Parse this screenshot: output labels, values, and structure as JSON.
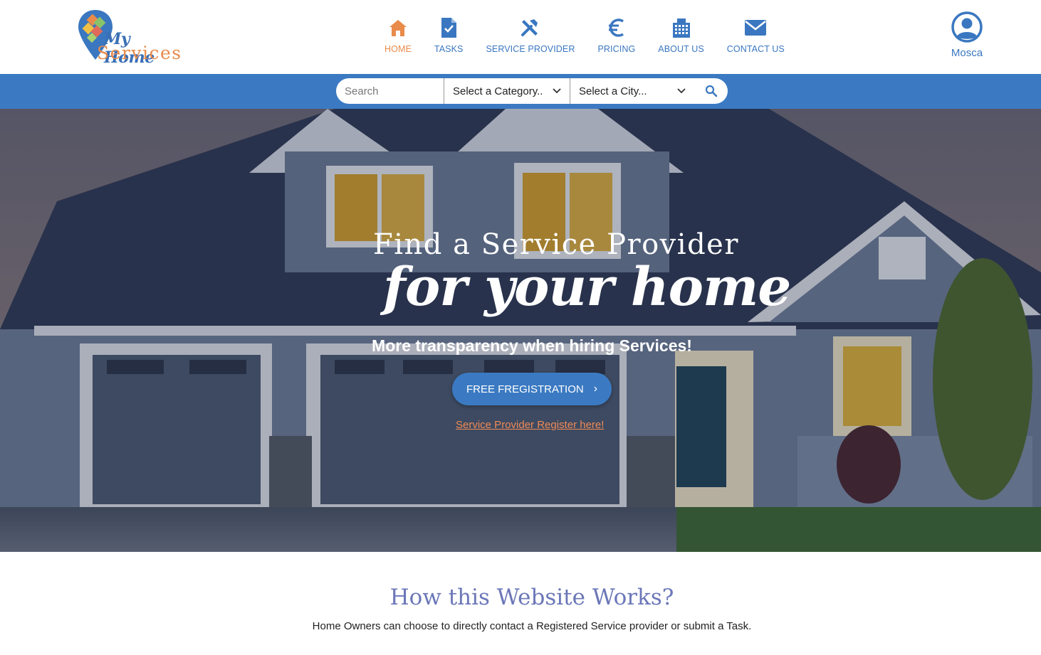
{
  "brand": {
    "line1": "My Home",
    "line2": "Services",
    "colors": {
      "primary": "#3b7ac2",
      "accent": "#e98b4a",
      "heading": "#6b77b8"
    }
  },
  "nav": {
    "items": [
      {
        "label": "HOME",
        "icon": "home-icon",
        "active": true
      },
      {
        "label": "TASKS",
        "icon": "task-check-icon",
        "active": false
      },
      {
        "label": "SERVICE PROVIDER",
        "icon": "tools-icon",
        "active": false
      },
      {
        "label": "PRICING",
        "icon": "euro-icon",
        "active": false
      },
      {
        "label": "ABOUT US",
        "icon": "building-icon",
        "active": false
      },
      {
        "label": "CONTACT US",
        "icon": "envelope-icon",
        "active": false
      }
    ]
  },
  "user": {
    "name": "Mosca",
    "icon": "user-avatar-icon"
  },
  "search": {
    "placeholder": "Search",
    "category_value": "Select a Category..",
    "city_value": "Select a City..."
  },
  "hero": {
    "title_line1": "Find a Service Provider",
    "title_line2": "for your home",
    "subtitle": "More transparency when hiring Services!",
    "cta_label": "FREE FREGISTRATION",
    "provider_link": "Service Provider Register here!"
  },
  "how": {
    "title": "How this Website Works?",
    "description": "Home Owners can choose to directly contact a Registered Service provider or submit a Task."
  }
}
